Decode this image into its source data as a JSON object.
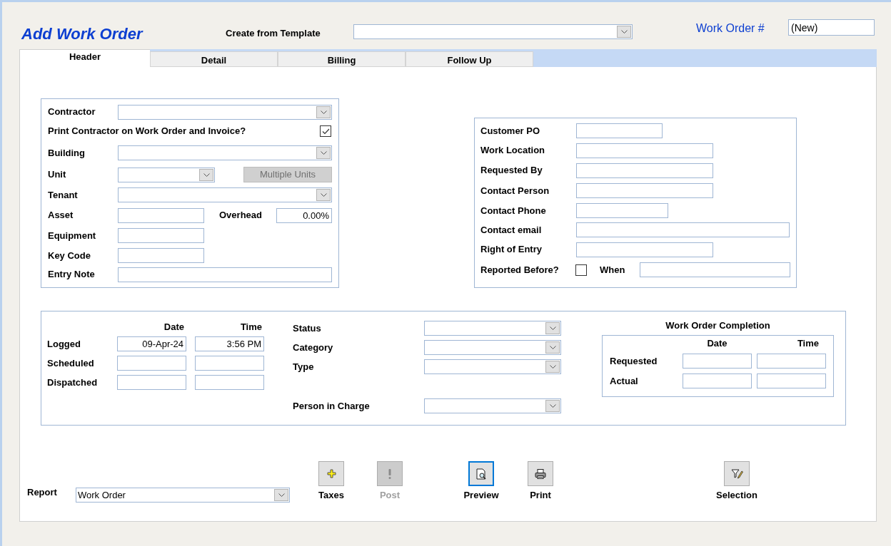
{
  "title": "Add Work Order",
  "template": {
    "label": "Create from Template"
  },
  "work_order_number": {
    "label": "Work Order #",
    "value": "(New)"
  },
  "tabs": [
    {
      "label": "Header",
      "selected": true
    },
    {
      "label": "Detail",
      "selected": false
    },
    {
      "label": "Billing",
      "selected": false
    },
    {
      "label": "Follow Up",
      "selected": false
    }
  ],
  "contractor_panel": {
    "contractor": {
      "label": "Contractor"
    },
    "print_contractor": {
      "label": "Print Contractor on Work Order and Invoice?",
      "checked": true
    },
    "building": {
      "label": "Building"
    },
    "unit": {
      "label": "Unit"
    },
    "multiple_units": {
      "label": "Multiple Units",
      "disabled": true
    },
    "tenant": {
      "label": "Tenant"
    },
    "asset": {
      "label": "Asset"
    },
    "overhead": {
      "label": "Overhead",
      "value": "0.00%"
    },
    "equipment": {
      "label": "Equipment"
    },
    "key_code": {
      "label": "Key Code"
    },
    "entry_note": {
      "label": "Entry Note"
    }
  },
  "customer_panel": {
    "fields": [
      {
        "label": "Customer PO"
      },
      {
        "label": "Work Location"
      },
      {
        "label": "Requested By"
      },
      {
        "label": "Contact Person"
      },
      {
        "label": "Contact Phone"
      },
      {
        "label": "Contact email"
      },
      {
        "label": "Right of Entry"
      }
    ],
    "reported_before": {
      "label": "Reported Before?",
      "checked": false
    },
    "when": {
      "label": "When"
    }
  },
  "schedule_panel": {
    "date_header": "Date",
    "time_header": "Time",
    "rows": [
      {
        "label": "Logged",
        "date": "09-Apr-24",
        "time": "3:56 PM"
      },
      {
        "label": "Scheduled"
      },
      {
        "label": "Dispatched"
      }
    ],
    "dropdowns": [
      {
        "label": "Status"
      },
      {
        "label": "Category"
      },
      {
        "label": "Type"
      },
      {
        "label": "Person in Charge"
      }
    ],
    "completion": {
      "title": "Work Order Completion",
      "date_header": "Date",
      "time_header": "Time",
      "rows": [
        {
          "label": "Requested"
        },
        {
          "label": "Actual"
        }
      ]
    }
  },
  "report": {
    "label": "Report",
    "value": "Work Order"
  },
  "buttons": [
    {
      "kind": "plus",
      "label": "Taxes",
      "disabled": false,
      "focused": false
    },
    {
      "kind": "exclamation",
      "label": "Post",
      "disabled": true,
      "focused": false
    },
    {
      "kind": "preview",
      "label": "Preview",
      "disabled": false,
      "focused": true
    },
    {
      "kind": "print",
      "label": "Print",
      "disabled": false,
      "focused": false
    },
    {
      "kind": "selection",
      "label": "Selection",
      "disabled": false,
      "focused": false
    }
  ]
}
